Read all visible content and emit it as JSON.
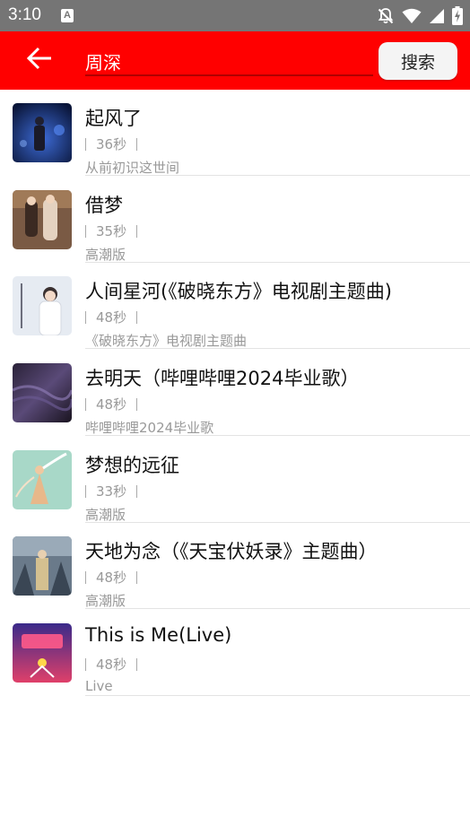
{
  "status_bar": {
    "time": "3:10",
    "notification_icon": "A",
    "icons": [
      "bell-off-icon",
      "wifi-icon",
      "signal-icon",
      "battery-charging-icon"
    ]
  },
  "toolbar": {
    "background": "#ff0000",
    "back_icon": "arrow-left-icon",
    "search_value": "周深",
    "search_button_label": "搜索"
  },
  "songs": [
    {
      "title": "起风了",
      "duration": "36秒",
      "subtitle": "从前初识这世间"
    },
    {
      "title": "借梦",
      "duration": "35秒",
      "subtitle": "高潮版"
    },
    {
      "title": "人间星河(《破晓东方》电视剧主题曲)",
      "duration": "48秒",
      "subtitle": "《破晓东方》电视剧主题曲"
    },
    {
      "title": "去明天（哔哩哔哩2024毕业歌）",
      "duration": "48秒",
      "subtitle": "哔哩哔哩2024毕业歌"
    },
    {
      "title": "梦想的远征",
      "duration": "33秒",
      "subtitle": "高潮版"
    },
    {
      "title": "天地为念（《天宝伏妖录》主题曲）",
      "duration": "48秒",
      "subtitle": "高潮版"
    },
    {
      "title": "This is Me(Live)",
      "duration": "48秒",
      "subtitle": "Live"
    }
  ]
}
